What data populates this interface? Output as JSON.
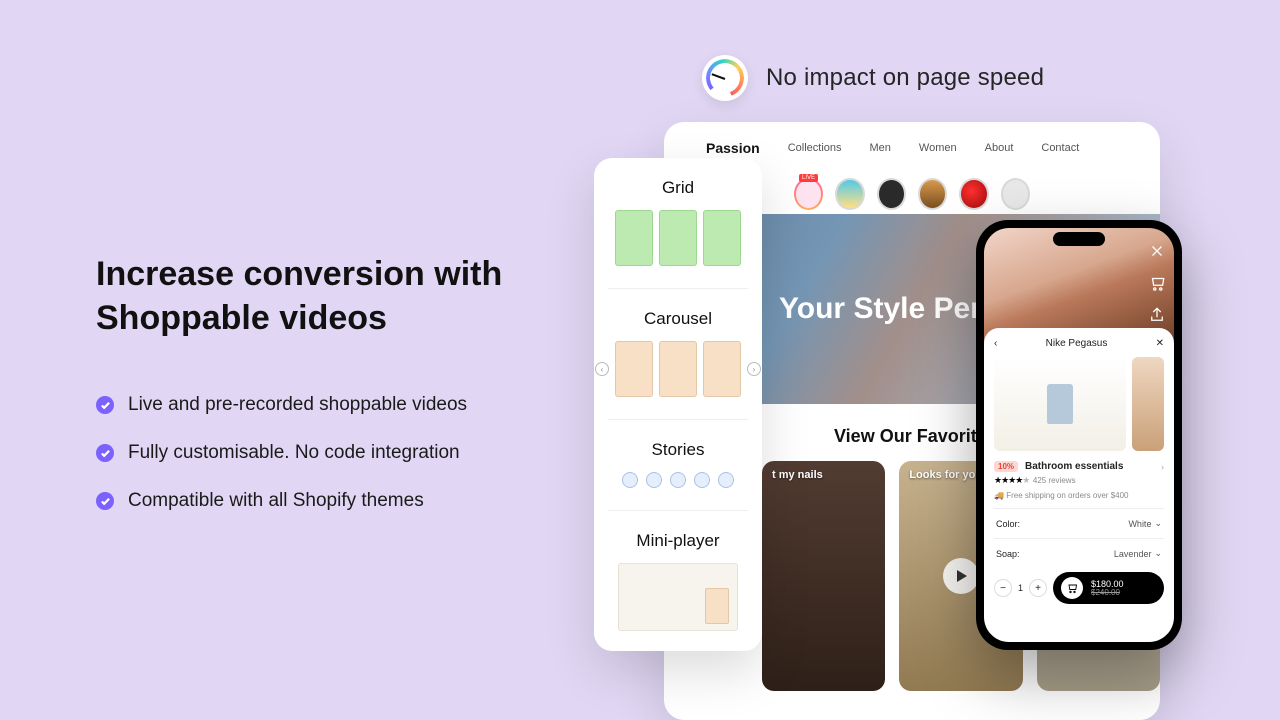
{
  "speed_label": "No impact on page speed",
  "headline": "Increase conversion with Shoppable videos",
  "bullets": [
    "Live and pre-recorded shoppable videos",
    "Fully customisable.  No code integration",
    "Compatible with all Shopify  themes"
  ],
  "formats": {
    "grid": "Grid",
    "carousel": "Carousel",
    "stories": "Stories",
    "mini": "Mini-player"
  },
  "site": {
    "brand": "Passion",
    "nav": [
      "Collections",
      "Men",
      "Women",
      "About",
      "Contact"
    ],
    "live": "LIVE",
    "hero": "Your Style Perfect",
    "section": "View Our Favorite",
    "cards": [
      "t my nails",
      "Looks for you"
    ]
  },
  "phone": {
    "sheet_title": "Nike Pegasus",
    "discount": "10%",
    "product": "Bathroom essentials",
    "reviews": "425 reviews",
    "shipping": "Free shipping on orders over $400",
    "color_label": "Color:",
    "color_value": "White",
    "soap_label": "Soap:",
    "soap_value": "Lavender",
    "qty": "1",
    "price": "$180.00",
    "old_price": "$240.00"
  }
}
